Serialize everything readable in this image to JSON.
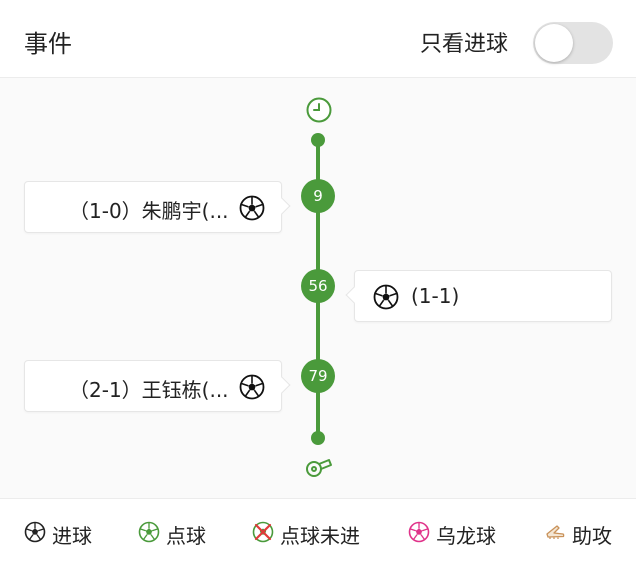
{
  "header": {
    "title": "事件",
    "filter_label": "只看进球",
    "filter_on": false
  },
  "timeline": {
    "events": [
      {
        "minute": "9",
        "side": "left",
        "text": "（1-0）朱鹏宇(...",
        "type": "goal-icon"
      },
      {
        "minute": "56",
        "side": "right",
        "text": "(1-1)",
        "type": "goal-icon"
      },
      {
        "minute": "79",
        "side": "left",
        "text": "（2-1）王钰栋(...",
        "type": "goal-icon"
      }
    ]
  },
  "legend": {
    "goal": "进球",
    "penalty": "点球",
    "penalty_missed": "点球未进",
    "own_goal": "乌龙球",
    "assist": "助攻"
  },
  "colors": {
    "timeline_green": "#4a9a3b",
    "own_goal_pink": "#e0338a",
    "miss_red": "#e03a3a",
    "assist_tan": "#c9925a"
  }
}
